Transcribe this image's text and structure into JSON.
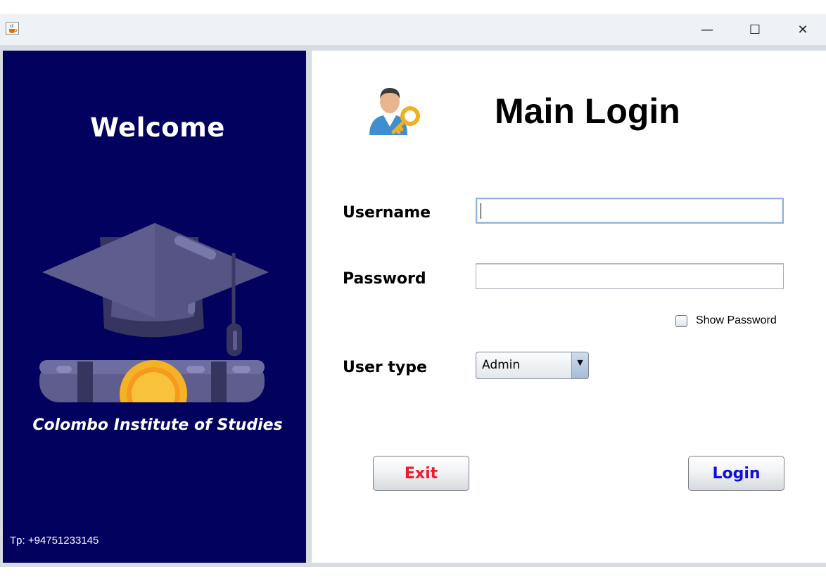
{
  "window": {
    "minimize_glyph": "—",
    "maximize_glyph": "☐",
    "close_glyph": "✕",
    "app_icon": "java-cup-icon"
  },
  "left_panel": {
    "welcome": "Welcome",
    "illustration": "graduation-cap-diploma-icon",
    "institute": "Colombo Institute of Studies",
    "phone": "Tp: +94751233145",
    "background_color": "#02015e"
  },
  "login": {
    "icon": "user-key-icon",
    "title": "Main Login",
    "username_label": "Username",
    "username_value": "",
    "password_label": "Password",
    "password_value": "",
    "show_password_label": "Show Password",
    "show_password_checked": false,
    "usertype_label": "User type",
    "usertype_value": "Admin",
    "exit_label": "Exit",
    "login_label": "Login",
    "exit_color": "#ee1c2e",
    "login_color": "#1010d8"
  }
}
